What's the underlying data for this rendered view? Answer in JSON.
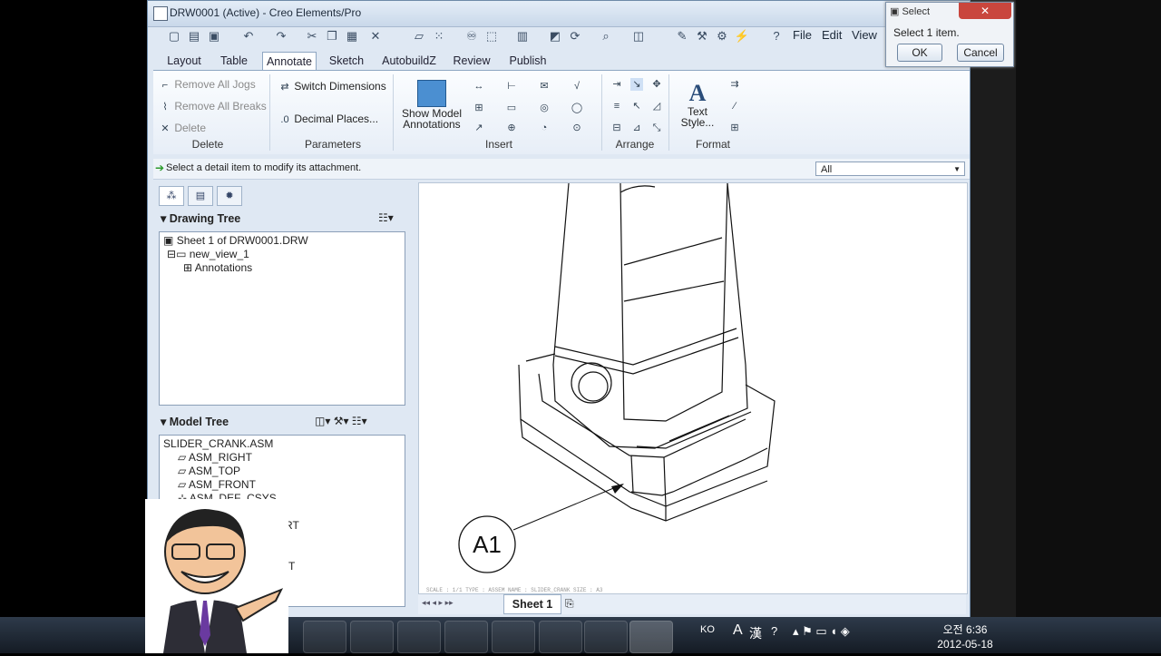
{
  "window": {
    "title": "DRW0001 (Active) - Creo Elements/Pro"
  },
  "menu": {
    "file": "File",
    "edit": "Edit",
    "view": "View"
  },
  "tabs": [
    {
      "label": "Layout"
    },
    {
      "label": "Table"
    },
    {
      "label": "Annotate"
    },
    {
      "label": "Sketch"
    },
    {
      "label": "AutobuildZ"
    },
    {
      "label": "Review"
    },
    {
      "label": "Publish"
    }
  ],
  "ribbon": {
    "delete_group": {
      "remove_jogs": "Remove All Jogs",
      "remove_breaks": "Remove All Breaks",
      "delete": "Delete",
      "label": "Delete"
    },
    "parameters_group": {
      "switch_dims": "Switch Dimensions",
      "decimal": "Decimal Places...",
      "label": "Parameters"
    },
    "insert_group": {
      "show_model_1": "Show Model",
      "show_model_2": "Annotations",
      "label": "Insert"
    },
    "arrange_group": {
      "label": "Arrange"
    },
    "format_group": {
      "text_style_1": "Text",
      "text_style_2": "Style...",
      "label": "Format"
    }
  },
  "status": {
    "message": "Select a detail item to modify its attachment.",
    "filter": "All"
  },
  "drawing_tree": {
    "title": "Drawing Tree",
    "items": [
      "Sheet 1 of DRW0001.DRW",
      "new_view_1",
      "Annotations"
    ]
  },
  "model_tree": {
    "title": "Model Tree",
    "items": [
      "SLIDER_CRANK.ASM",
      "ASM_RIGHT",
      "ASM_TOP",
      "ASM_FRONT",
      "ASM_DEF_CSYS",
      "RT",
      "T"
    ]
  },
  "canvas": {
    "balloon": "A1",
    "footer": "SCALE : 1/1    TYPE : ASSEM  NAME : SLIDER_CRANK  SIZE : A3"
  },
  "sheet": {
    "tab": "Sheet 1"
  },
  "select_dialog": {
    "title": "Select",
    "message": "Select 1 item.",
    "ok": "OK",
    "cancel": "Cancel"
  },
  "taskbar": {
    "lang": "KO",
    "ime1": "A",
    "ime2": "漢",
    "time": "오전 6:36",
    "date": "2012-05-18"
  }
}
